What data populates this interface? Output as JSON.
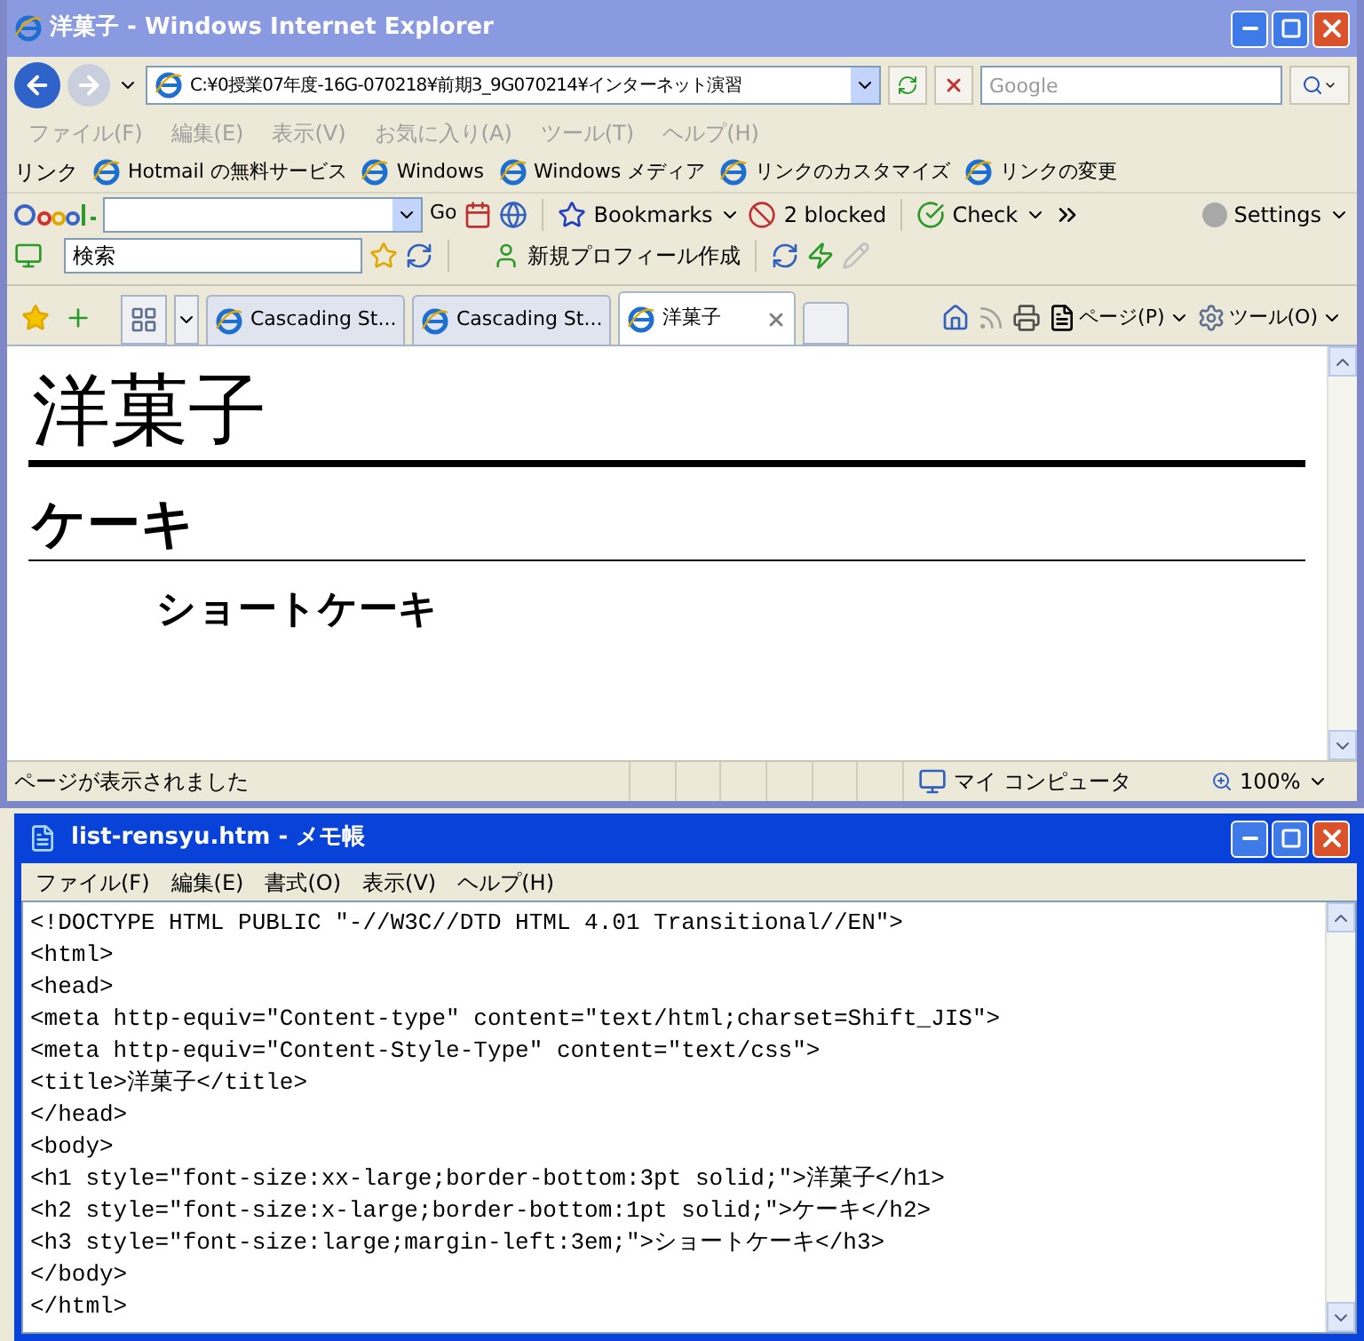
{
  "browser": {
    "title": "洋菓子 - Windows Internet Explorer",
    "address": "C:¥0授業07年度-16G-070218¥前期3_9G070214¥インターネット演習",
    "search_placeholder": "Google",
    "menu": [
      "ファイル(F)",
      "編集(E)",
      "表示(V)",
      "お気に入り(A)",
      "ツール(T)",
      "ヘルプ(H)"
    ],
    "links_label": "リンク",
    "links": [
      "Hotmail の無料サービス",
      "Windows",
      "Windows メディア",
      "リンクのカスタマイズ",
      "リンクの変更"
    ],
    "google_toolbar": {
      "go": "Go",
      "bookmarks": "Bookmarks",
      "blocked": "2 blocked",
      "check": "Check",
      "settings": "Settings"
    },
    "second_toolbar": {
      "search_value": "検索",
      "profile": "新規プロフィール作成"
    },
    "tabs": [
      {
        "label": "Cascading St...",
        "selected": false
      },
      {
        "label": "Cascading St...",
        "selected": false
      },
      {
        "label": "洋菓子",
        "selected": true
      }
    ],
    "command_bar": {
      "page": "ページ(P)",
      "tools": "ツール(O)"
    },
    "content": [
      {
        "kind": "h1",
        "text": "洋菓子"
      },
      {
        "kind": "h2",
        "text": "ケーキ"
      },
      {
        "kind": "h3",
        "text": "ショートケーキ"
      }
    ],
    "status_bar": {
      "text": "ページが表示されました",
      "zone": "マイ コンピュータ",
      "zoom": "100%"
    }
  },
  "notepad": {
    "title": "list-rensyu.htm - メモ帳",
    "menu": [
      "ファイル(F)",
      "編集(E)",
      "書式(O)",
      "表示(V)",
      "ヘルプ(H)"
    ],
    "lines": [
      "<!DOCTYPE HTML PUBLIC \"-//W3C//DTD HTML 4.01 Transitional//EN\">",
      "<html>",
      "<head>",
      "<meta http-equiv=\"Content-type\" content=\"text/html;charset=Shift_JIS\">",
      "<meta http-equiv=\"Content-Style-Type\" content=\"text/css\">",
      "<title>洋菓子</title>",
      "</head>",
      "<body>",
      "<h1 style=\"font-size:xx-large;border-bottom:3pt solid;\">洋菓子</h1>",
      "<h2 style=\"font-size:x-large;border-bottom:1pt solid;\">ケーキ</h2>",
      "<h3 style=\"font-size:large;margin-left:3em;\">ショートケーキ</h3>",
      "</body>",
      "</html>"
    ]
  }
}
